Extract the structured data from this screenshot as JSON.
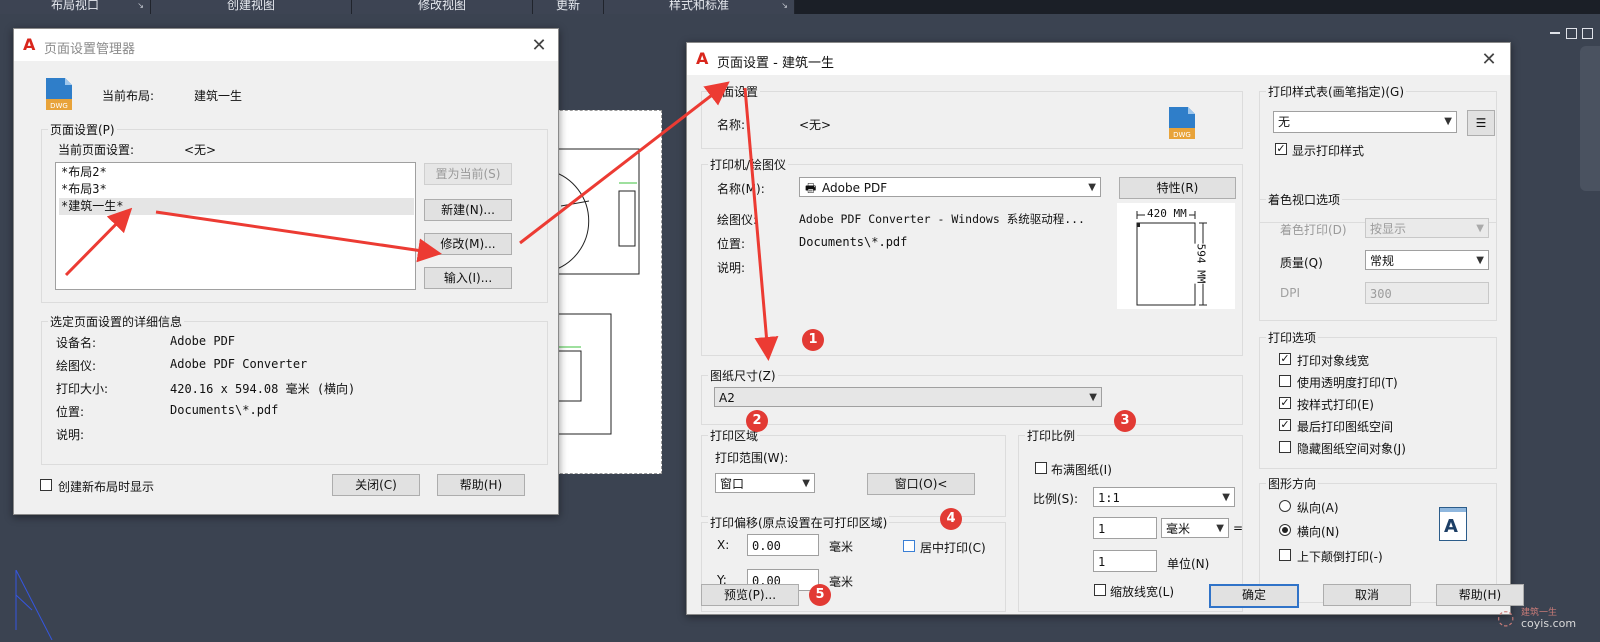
{
  "ribbon": {
    "tabs": [
      "布局视口",
      "创建视图",
      "修改视图",
      "更新",
      "样式和标准"
    ]
  },
  "manager": {
    "title": "页面设置管理器",
    "current_layout_label": "当前布局:",
    "current_layout_value": "建筑一生",
    "page_setup_group": "页面设置(P)",
    "current_page_setup_label": "当前页面设置:",
    "current_page_setup_value": "<无>",
    "list_items": [
      "*布局2*",
      "*布局3*",
      "*建筑一生*"
    ],
    "set_current_button": "置为当前(S)",
    "new_button": "新建(N)...",
    "modify_button": "修改(M)...",
    "import_button": "输入(I)...",
    "details_group": "选定页面设置的详细信息",
    "details": [
      {
        "label": "设备名:",
        "value": "Adobe PDF"
      },
      {
        "label": "绘图仪:",
        "value": "Adobe PDF Converter"
      },
      {
        "label": "打印大小:",
        "value": "420.16 x 594.08 毫米 (横向)"
      },
      {
        "label": "位置:",
        "value": "Documents\\*.pdf"
      },
      {
        "label": "说明:",
        "value": ""
      }
    ],
    "show_on_new_layout": "创建新布局时显示",
    "close_button": "关闭(C)",
    "help_button": "帮助(H)"
  },
  "pagesetup": {
    "title": "页面设置 - 建筑一生",
    "page_setup_group": "页面设置",
    "name_label": "名称:",
    "name_value": "<无>",
    "printer_group": "打印机/绘图仪",
    "printer_name_label": "名称(M):",
    "printer_name_value": "Adobe PDF",
    "properties_button": "特性(R)",
    "plotter_label": "绘图仪:",
    "plotter_value": "Adobe PDF Converter - Windows 系统驱动程...",
    "location_label": "位置:",
    "location_value": "Documents\\*.pdf",
    "description_label": "说明:",
    "paper_width": "420 MM",
    "paper_height": "594 MM",
    "paper_size_group": "图纸尺寸(Z)",
    "paper_size_value": "A2",
    "plot_area_group": "打印区域",
    "plot_range_label": "打印范围(W):",
    "plot_range_value": "窗口",
    "window_button": "窗口(O)<",
    "plot_offset_group": "打印偏移(原点设置在可打印区域)",
    "x_label": "X:",
    "x_value": "0.00",
    "y_label": "Y:",
    "y_value": "0.00",
    "unit_mm": "毫米",
    "center_plot": "居中打印(C)",
    "plot_scale_group": "打印比例",
    "fit_to_paper": "布满图纸(I)",
    "scale_label": "比例(S):",
    "scale_value": "1:1",
    "scale_num": "1",
    "scale_unit": "毫米",
    "equals": "=",
    "scale_den": "1",
    "unit_label": "单位(N)",
    "scale_lineweights": "缩放线宽(L)",
    "plot_style_group": "打印样式表(画笔指定)(G)",
    "plot_style_value": "无",
    "show_plot_styles": "显示打印样式",
    "shaded_group": "着色视口选项",
    "shade_plot_label": "着色打印(D)",
    "shade_plot_value": "按显示",
    "quality_label": "质量(Q)",
    "quality_value": "常规",
    "dpi_label": "DPI",
    "dpi_value": "300",
    "plot_options_group": "打印选项",
    "options": [
      {
        "label": "打印对象线宽",
        "checked": true
      },
      {
        "label": "使用透明度打印(T)",
        "checked": false
      },
      {
        "label": "按样式打印(E)",
        "checked": true
      },
      {
        "label": "最后打印图纸空间",
        "checked": true
      },
      {
        "label": "隐藏图纸空间对象(J)",
        "checked": false
      }
    ],
    "orientation_group": "图形方向",
    "portrait": "纵向(A)",
    "landscape": "横向(N)",
    "upside_down": "上下颠倒打印(-)",
    "orientation_glyph": "A",
    "preview_button": "预览(P)...",
    "ok_button": "确定",
    "cancel_button": "取消",
    "help_button": "帮助(H)"
  },
  "badges": [
    "1",
    "2",
    "3",
    "4",
    "5"
  ],
  "watermark": {
    "line1": "建筑一生",
    "line2": "coyis.com"
  },
  "colors": {
    "arrow": "#ec3b33",
    "badge": "#e23a34",
    "accent": "#3073c8"
  }
}
